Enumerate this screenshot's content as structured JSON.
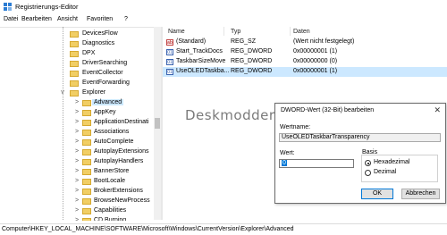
{
  "window": {
    "title": "Registrierungs-Editor"
  },
  "menu": [
    "Datei",
    "Bearbeiten",
    "Ansicht",
    "Favoriten",
    "?"
  ],
  "tree": {
    "items": [
      {
        "label": "DevicesFlow",
        "chevron": ""
      },
      {
        "label": "Diagnostics",
        "chevron": ""
      },
      {
        "label": "DPX",
        "chevron": ""
      },
      {
        "label": "DriverSearching",
        "chevron": ""
      },
      {
        "label": "EventCollector",
        "chevron": ""
      },
      {
        "label": "EventForwarding",
        "chevron": ""
      },
      {
        "label": "Explorer",
        "chevron": "v"
      },
      {
        "label": "Advanced",
        "chevron": ">"
      },
      {
        "label": "AppKey",
        "chevron": ">"
      },
      {
        "label": "ApplicationDestinati",
        "chevron": ">"
      },
      {
        "label": "Associations",
        "chevron": ">"
      },
      {
        "label": "AutoComplete",
        "chevron": ">"
      },
      {
        "label": "AutoplayExtensions",
        "chevron": ">"
      },
      {
        "label": "AutoplayHandlers",
        "chevron": ">"
      },
      {
        "label": "BannerStore",
        "chevron": ">"
      },
      {
        "label": "BootLocale",
        "chevron": ">"
      },
      {
        "label": "BrokerExtensions",
        "chevron": ">"
      },
      {
        "label": "BrowseNewProcess",
        "chevron": ">"
      },
      {
        "label": "Capabilities",
        "chevron": ">"
      },
      {
        "label": "CD Burning",
        "chevron": ">"
      }
    ]
  },
  "list": {
    "headers": {
      "name": "Name",
      "type": "Typ",
      "data": "Daten"
    },
    "rows": [
      {
        "icon": "ab",
        "name": "(Standard)",
        "type": "REG_SZ",
        "data": "(Wert nicht festgelegt)"
      },
      {
        "icon": "01",
        "name": "Start_TrackDocs",
        "type": "REG_DWORD",
        "data": "0x00000001 (1)"
      },
      {
        "icon": "01",
        "name": "TaskbarSizeMove",
        "type": "REG_DWORD",
        "data": "0x00000000 (0)"
      },
      {
        "icon": "01",
        "name": "UseOLEDTaskba...",
        "type": "REG_DWORD",
        "data": "0x00000001 (1)"
      }
    ]
  },
  "watermark": "Deskmodder.de",
  "dialog": {
    "title": "DWORD-Wert (32-Bit) bearbeiten",
    "close": "✕",
    "name_label": "Wertname:",
    "name_value": "UseOLEDTaskbarTransparency",
    "value_label": "Wert:",
    "value_value": "0",
    "base_label": "Basis",
    "hex_label": "Hexadezimal",
    "dec_label": "Dezimal",
    "base_selected": "Hexadezimal",
    "ok": "OK",
    "cancel": "Abbrechen"
  },
  "status": {
    "path": "Computer\\HKEY_LOCAL_MACHINE\\SOFTWARE\\Microsoft\\Windows\\CurrentVersion\\Explorer\\Advanced"
  },
  "colors": {
    "selection": "#cce8ff",
    "folder": "#f1ce64",
    "accent": "#0078d7"
  }
}
